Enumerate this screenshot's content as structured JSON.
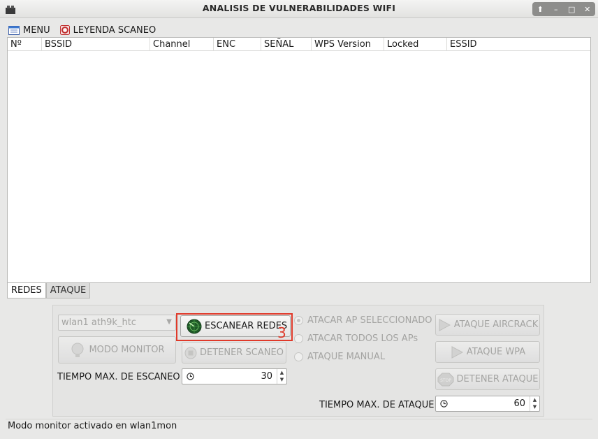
{
  "window": {
    "title": "ANALISIS DE VULNERABILIDADES WIFI",
    "controls": [
      "⬆",
      "–",
      "□",
      "✕"
    ]
  },
  "menubar": {
    "menu_label": "MENU",
    "legend_label": "LEYENDA SCANEO"
  },
  "table": {
    "columns": [
      "Nº",
      "BSSID",
      "Channel",
      "ENC",
      "SEÑAL",
      "WPS Version",
      "Locked",
      "ESSID"
    ]
  },
  "tabs": [
    {
      "label": "REDES",
      "active": true
    },
    {
      "label": "ATAQUE",
      "active": false
    }
  ],
  "controls": {
    "interface_select": "wlan1 ath9k_htc",
    "monitor_mode_button": "MODO MONITOR",
    "scan_button": "ESCANEAR REDES",
    "stop_scan_button": "DETENER SCANEO",
    "annotation_number": "3",
    "radio_selected_ap": "ATACAR AP SELECCIONADO",
    "radio_all_aps": "ATACAR TODOS LOS APs",
    "radio_manual": "ATAQUE MANUAL",
    "aircrack_button": "ATAQUE AIRCRACK",
    "wpa_button": "ATAQUE WPA",
    "stop_attack_button": "DETENER ATAQUE",
    "stop_badge": "STOP",
    "scan_time_label": "TIEMPO MAX. DE ESCANEO",
    "scan_time_value": "30",
    "attack_time_label": "TIEMPO MAX. DE ATAQUE",
    "attack_time_value": "60"
  },
  "status": {
    "message": "Modo monitor activado en wlan1mon"
  },
  "colors": {
    "highlight": "#e03a2a",
    "scan_icon": "#2f7d36"
  }
}
